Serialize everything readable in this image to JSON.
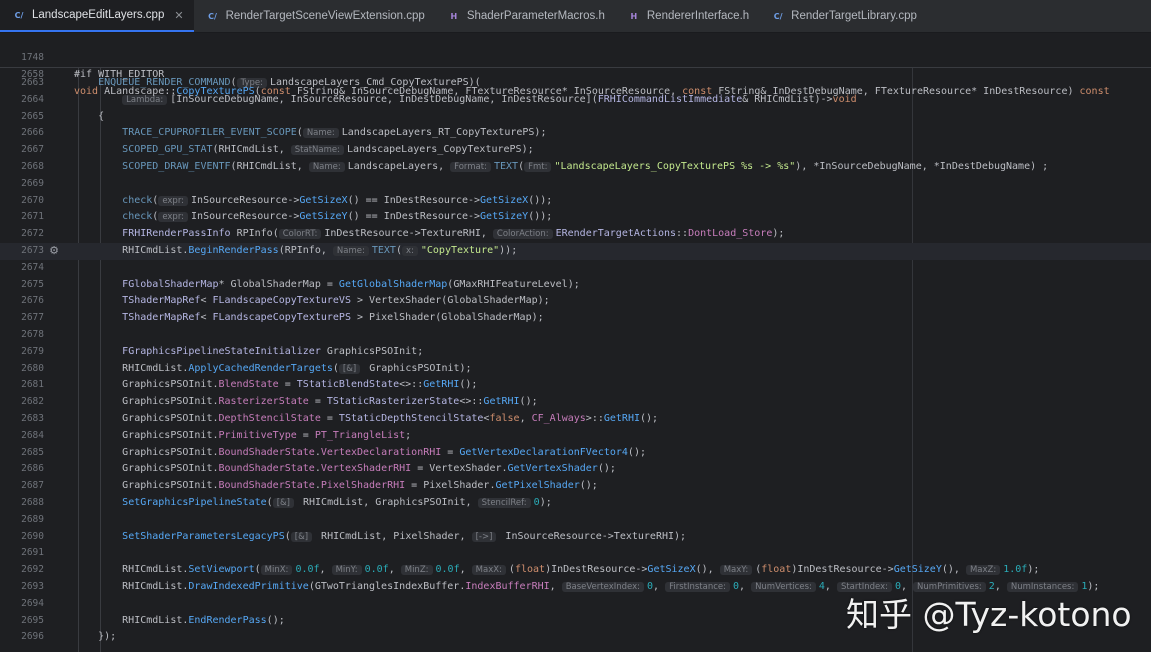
{
  "tabs": [
    {
      "label": "LandscapeEditLayers.cpp",
      "kind": "C++",
      "active": true
    },
    {
      "label": "RenderTargetSceneViewExtension.cpp",
      "kind": "C++",
      "active": false
    },
    {
      "label": "ShaderParameterMacros.h",
      "kind": "H",
      "active": false
    },
    {
      "label": "RendererInterface.h",
      "kind": "H",
      "active": false
    },
    {
      "label": "RenderTargetLibrary.cpp",
      "kind": "C++",
      "active": false
    }
  ],
  "sticky": [
    {
      "n": "1748",
      "code": "#if WITH_EDITOR"
    },
    {
      "n": "2658",
      "code": "void ALandscape::CopyTexturePS(const FString& InSourceDebugName, FTextureResource* InSourceResource, const FString& InDestDebugName, FTextureResource* InDestResource) const"
    }
  ],
  "lines": [
    {
      "n": "2663",
      "code": "    ENQUEUE_RENDER_COMMAND(Type: LandscapeLayers_Cmd_CopyTexturePS)("
    },
    {
      "n": "2664",
      "code": "        Lambda: [InSourceDebugName, InSourceResource, InDestDebugName, InDestResource](FRHICommandListImmediate& RHICmdList)->void"
    },
    {
      "n": "2665",
      "code": "    {"
    },
    {
      "n": "2666",
      "code": "        TRACE_CPUPROFILER_EVENT_SCOPE(Name: LandscapeLayers_RT_CopyTexturePS);"
    },
    {
      "n": "2667",
      "code": "        SCOPED_GPU_STAT(RHICmdList, StatName: LandscapeLayers_CopyTexturePS);"
    },
    {
      "n": "2668",
      "code": "        SCOPED_DRAW_EVENTF(RHICmdList, Name: LandscapeLayers, Format: TEXT(Fmt: \"LandscapeLayers_CopyTexturePS %s -> %s\"), *InSourceDebugName, *InDestDebugName) ;"
    },
    {
      "n": "2669",
      "code": ""
    },
    {
      "n": "2670",
      "code": "        check(expr: InSourceResource->GetSizeX() == InDestResource->GetSizeX());"
    },
    {
      "n": "2671",
      "code": "        check(expr: InSourceResource->GetSizeY() == InDestResource->GetSizeY());"
    },
    {
      "n": "2672",
      "code": "        FRHIRenderPassInfo RPInfo(ColorRT: InDestResource->TextureRHI, ColorAction: ERenderTargetActions::DontLoad_Store);"
    },
    {
      "n": "2673",
      "code": "        RHICmdList.BeginRenderPass(RPInfo, Name: TEXT(x: \"CopyTexture\"));"
    },
    {
      "n": "2674",
      "code": ""
    },
    {
      "n": "2675",
      "code": "        FGlobalShaderMap* GlobalShaderMap = GetGlobalShaderMap(GMaxRHIFeatureLevel);"
    },
    {
      "n": "2676",
      "code": "        TShaderMapRef< FLandscapeCopyTextureVS > VertexShader(GlobalShaderMap);"
    },
    {
      "n": "2677",
      "code": "        TShaderMapRef< FLandscapeCopyTexturePS > PixelShader(GlobalShaderMap);"
    },
    {
      "n": "2678",
      "code": ""
    },
    {
      "n": "2679",
      "code": "        FGraphicsPipelineStateInitializer GraphicsPSOInit;"
    },
    {
      "n": "2680",
      "code": "        RHICmdList.ApplyCachedRenderTargets([&] GraphicsPSOInit);"
    },
    {
      "n": "2681",
      "code": "        GraphicsPSOInit.BlendState = TStaticBlendState<>::GetRHI();"
    },
    {
      "n": "2682",
      "code": "        GraphicsPSOInit.RasterizerState = TStaticRasterizerState<>::GetRHI();"
    },
    {
      "n": "2683",
      "code": "        GraphicsPSOInit.DepthStencilState = TStaticDepthStencilState<false, CF_Always>::GetRHI();"
    },
    {
      "n": "2684",
      "code": "        GraphicsPSOInit.PrimitiveType = PT_TriangleList;"
    },
    {
      "n": "2685",
      "code": "        GraphicsPSOInit.BoundShaderState.VertexDeclarationRHI = GetVertexDeclarationFVector4();"
    },
    {
      "n": "2686",
      "code": "        GraphicsPSOInit.BoundShaderState.VertexShaderRHI = VertexShader.GetVertexShader();"
    },
    {
      "n": "2687",
      "code": "        GraphicsPSOInit.BoundShaderState.PixelShaderRHI = PixelShader.GetPixelShader();"
    },
    {
      "n": "2688",
      "code": "        SetGraphicsPipelineState([&] RHICmdList, GraphicsPSOInit, StencilRef: 0);"
    },
    {
      "n": "2689",
      "code": ""
    },
    {
      "n": "2690",
      "code": "        SetShaderParametersLegacyPS([&] RHICmdList, PixelShader, [->] InSourceResource->TextureRHI);"
    },
    {
      "n": "2691",
      "code": ""
    },
    {
      "n": "2692",
      "code": "        RHICmdList.SetViewport(MinX: 0.0f, MinY: 0.0f, MinZ: 0.0f, MaxX: (float)InDestResource->GetSizeX(), MaxY: (float)InDestResource->GetSizeY(), MaxZ: 1.0f);"
    },
    {
      "n": "2693",
      "code": "        RHICmdList.DrawIndexedPrimitive(GTwoTrianglesIndexBuffer.IndexBufferRHI, BaseVertexIndex: 0, FirstInstance: 0, NumVertices: 4, StartIndex: 0, NumPrimitives: 2, NumInstances: 1);"
    },
    {
      "n": "2694",
      "code": ""
    },
    {
      "n": "2695",
      "code": "        RHICmdList.EndRenderPass();"
    },
    {
      "n": "2696",
      "code": "    });"
    }
  ],
  "watermark": "知乎 @Tyz-kotono"
}
